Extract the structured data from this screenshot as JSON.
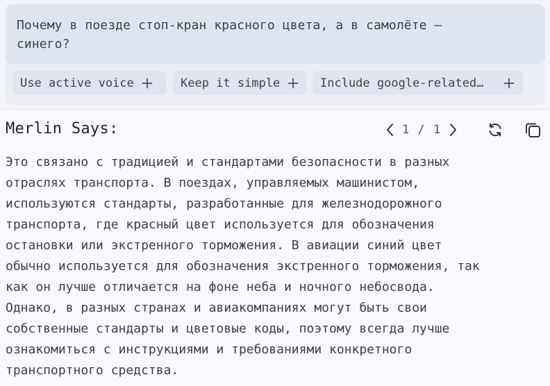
{
  "query": {
    "lines": [
      "Почему в поезде стоп-кран красного цвета, а в самолёте –",
      "синего?"
    ]
  },
  "chips": [
    {
      "label": "Use active voice",
      "icon": "plus-icon"
    },
    {
      "label": "Keep it simple",
      "icon": "plus-icon"
    },
    {
      "label": "Include google-related…",
      "icon": "plus-icon"
    }
  ],
  "response": {
    "title": "Merlin Says:",
    "pager": "1 / 1",
    "icons": [
      "chevron-left-icon",
      "chevron-right-icon",
      "refresh-icon",
      "copy-icon"
    ],
    "lines": [
      "Это связано с традицией и стандартами безопасности в разных",
      "отраслях транспорта. В поездах, управляемых машинистом,",
      "используются стандарты, разработанные для железнодорожного",
      "транспорта, где красный цвет используется для обозначения",
      "остановки или экстренного торможения. В авиации синий цвет",
      "обычно используется для обозначения экстренного торможения, так",
      "как он лучше отличается на фоне неба и ночного небосвода.",
      "Однако, в разных странах и авиакомпаниях могут быть свои",
      "собственные стандарты и цветовые коды, поэтому всегда лучше",
      "ознакомиться с инструкциями и требованиями конкретного",
      "транспортного средства."
    ]
  },
  "colors": {
    "panel_bg": "#f3f5fa",
    "query_bg": "#dfe5ee",
    "chip_bg": "#dfe5ee",
    "text": "#3a3f46",
    "title": "#1f2329"
  }
}
